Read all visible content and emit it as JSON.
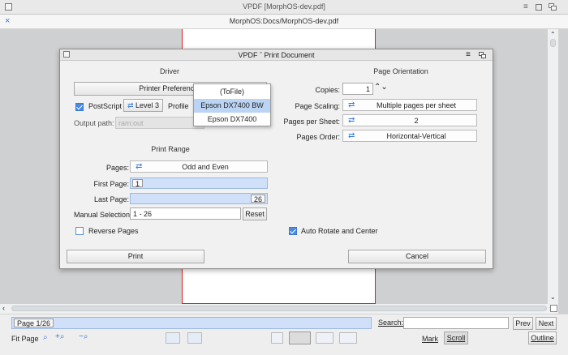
{
  "window": {
    "title": "VPDF [MorphOS-dev.pdf]",
    "path": "MorphOS:Docs/MorphOS-dev.pdf",
    "close_glyph": "×"
  },
  "dialog": {
    "title": "VPDF ˇ Print Document",
    "driver": {
      "section": "Driver",
      "printer_prefs_label": "Printer Preferences",
      "postscript_label": "PostScript",
      "postscript_checked": true,
      "level_label": "Level 3",
      "profile_label": "Profile",
      "output_path_label": "Output path:",
      "output_path_value": "ram:out"
    },
    "dropdown": {
      "items": [
        "(ToFile)",
        "Epson DX7400 BW",
        "Epson DX7400"
      ],
      "selected_index": 1
    },
    "print_range": {
      "section": "Print Range",
      "pages_label": "Pages:",
      "pages_value": "Odd and Even",
      "first_page_label": "First Page:",
      "first_page_value": "1",
      "last_page_label": "Last Page:",
      "last_page_value": "26",
      "manual_label": "Manual Selection",
      "manual_value": "1 - 26",
      "reset_label": "Reset",
      "reverse_label": "Reverse Pages",
      "reverse_checked": false
    },
    "orientation": {
      "section": "Page Orientation",
      "copies_label": "Copies:",
      "copies_value": "1",
      "scaling_label": "Page Scaling:",
      "scaling_value": "Multiple pages per sheet",
      "per_sheet_label": "Pages per Sheet:",
      "per_sheet_value": "2",
      "order_label": "Pages Order:",
      "order_value": "Horizontal-Vertical",
      "auto_rotate_label": "Auto Rotate and Center",
      "auto_rotate_checked": true
    },
    "print_button": "Print",
    "cancel_button": "Cancel"
  },
  "bottombar": {
    "page_indicator": "Page 1/26",
    "search_label": "Search:",
    "search_value": "",
    "prev_label": "Prev",
    "next_label": "Next",
    "fit_label": "Fit Page",
    "mark_label": "Mark",
    "scroll_label": "Scroll",
    "outline_label": "Outline"
  },
  "colors": {
    "accent": "#3a7bd5",
    "page_border": "#e02020",
    "selection": "#bcd4f4"
  }
}
